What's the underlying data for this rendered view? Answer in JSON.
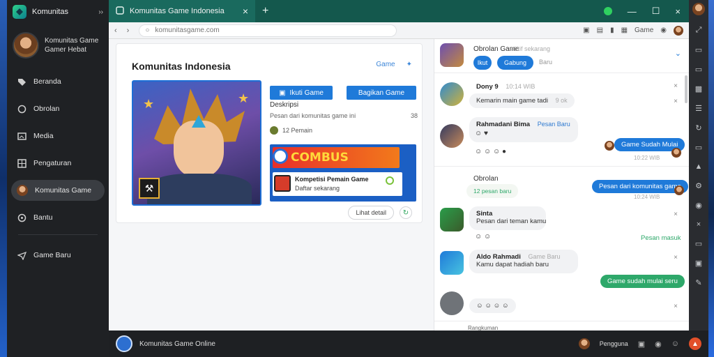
{
  "sidebar": {
    "app_name": "Komunitas",
    "collapse_icon": "double-chevron-icon",
    "user": {
      "line1": "Komunitas Game",
      "line2": "Gamer Hebat"
    },
    "items": [
      {
        "label": "Beranda",
        "icon": "tag-icon"
      },
      {
        "label": "Obrolan",
        "icon": "chat-icon"
      },
      {
        "label": "Media",
        "icon": "image-icon"
      },
      {
        "label": "Pengaturan",
        "icon": "grid-icon"
      },
      {
        "label": "Komunitas Game",
        "icon": "avatar"
      },
      {
        "label": "Bantu",
        "icon": "help-icon"
      },
      {
        "label": "Game Baru",
        "icon": "send-icon"
      }
    ]
  },
  "browser": {
    "tab_title": "Komunitas Game Indonesia",
    "url": "komunitasgame.com",
    "address_right_label": "Game"
  },
  "main": {
    "title": "Komunitas Indonesia",
    "action_label": "Game",
    "btn_join": "Ikuti Game",
    "btn_share": "Bagikan Game",
    "info_title": "Deskripsi",
    "info_desc": "Pesan dari komunitas game ini",
    "info_num": "38",
    "info_meta": "12 Pemain",
    "promo_banner": "COMBUS",
    "promo_line1": "Kompetisi Pemain Game",
    "promo_line2": "Daftar sekarang",
    "foot_button": "Lihat detail"
  },
  "chat": {
    "title": "Obrolan Game",
    "sub": "aktif sekarang",
    "btn_a": "Ikut",
    "btn_b": "Gabung",
    "meta": "Baru",
    "section_label": "Obrolan",
    "section_sub": "12 pesan baru",
    "messages": [
      {
        "name": "Dony 9",
        "time": "10:14 WIB",
        "text": "Kemarin main game tadi",
        "extra": "9 ok"
      },
      {
        "name": "Rahmadani Bima",
        "time": "Pesan Baru",
        "text": "",
        "extra": ""
      },
      {
        "name": "Sinta",
        "time": "",
        "text": "Pesan dari teman kamu",
        "extra": ""
      },
      {
        "name": "Aldo Rahmadi",
        "time": "Game Baru",
        "text": "Kamu dapat hadiah baru",
        "extra": ""
      }
    ],
    "right_1": "Game Sudah Mulai",
    "right_2": "Pesan dari komunitas game",
    "right_3": "Game sudah mulai seru",
    "right_meta_1": "10:22 WIB",
    "right_meta_2": "10:24 WIB",
    "green_label": "Pesan masuk",
    "preview_label": "Rangkuman"
  },
  "bottom": {
    "status_text": "Komunitas Game Online",
    "user_label": "Pengguna"
  }
}
